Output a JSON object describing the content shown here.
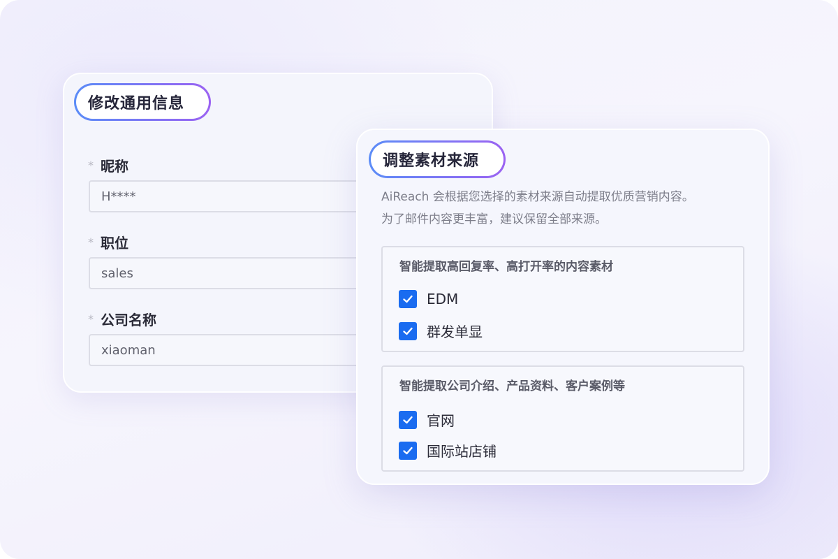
{
  "general_info": {
    "title": "修改通用信息",
    "required_mark": "*",
    "fields": [
      {
        "label": "昵称",
        "value": "H****"
      },
      {
        "label": "职位",
        "value": "sales"
      },
      {
        "label": "公司名称",
        "value": "xiaoman"
      }
    ]
  },
  "material_source": {
    "title": "调整素材来源",
    "description_line1": "AiReach 会根据您选择的素材来源自动提取优质营销内容。",
    "description_line2": "为了邮件内容更丰富，建议保留全部来源。",
    "groups": [
      {
        "title": "智能提取高回复率、高打开率的内容素材",
        "options": [
          {
            "label": "EDM",
            "checked": true
          },
          {
            "label": "群发单显",
            "checked": true
          }
        ]
      },
      {
        "title": "智能提取公司介绍、产品资料、客户案例等",
        "options": [
          {
            "label": "官网",
            "checked": true
          },
          {
            "label": "国际站店铺",
            "checked": true
          }
        ]
      }
    ]
  },
  "colors": {
    "checkbox": "#1a6cf0",
    "pill_gradient_start": "#5b8cf7",
    "pill_gradient_end": "#9b62f2"
  }
}
